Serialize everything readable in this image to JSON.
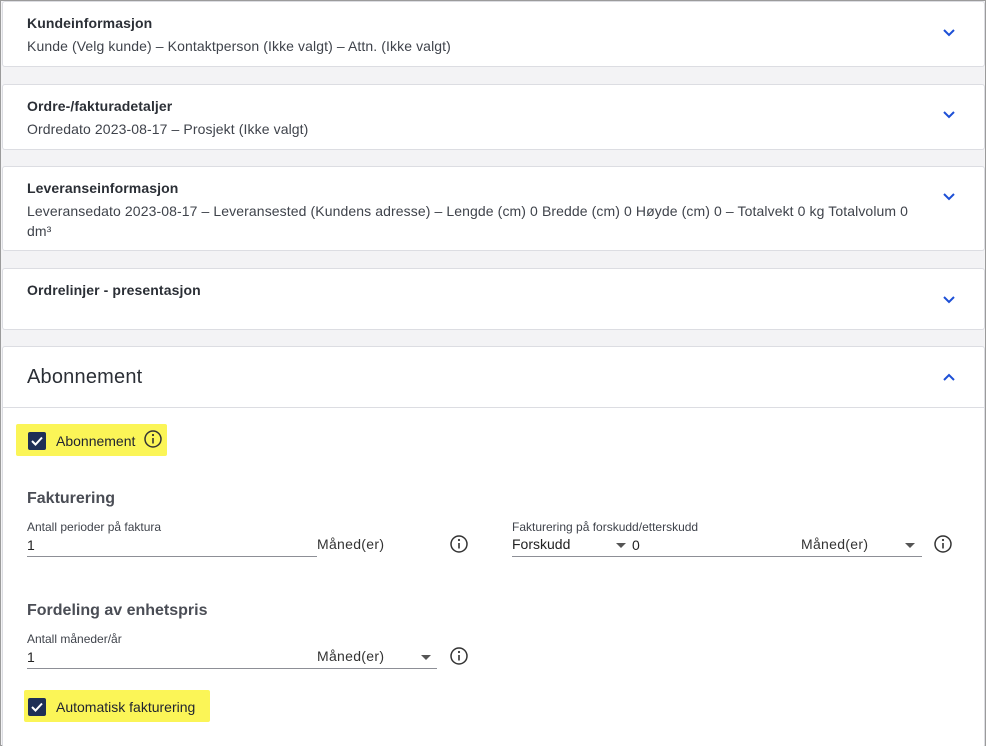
{
  "cards": [
    {
      "title": "Kundeinformasjon",
      "summary": "Kunde (Velg kunde) – Kontaktperson (Ikke valgt) – Attn. (Ikke valgt)"
    },
    {
      "title": "Ordre-/fakturadetaljer",
      "summary": "Ordredato 2023-08-17 – Prosjekt (Ikke valgt)"
    },
    {
      "title": "Leveranseinformasjon",
      "summary": "Leveransedato 2023-08-17 – Leveransested (Kundens adresse) – Lengde (cm) 0 Bredde (cm) 0 Høyde (cm) 0 – Totalvekt 0 kg Totalvolum 0 dm³"
    },
    {
      "title": "Ordrelinjer - presentasjon",
      "summary": ""
    }
  ],
  "subscription": {
    "title": "Abonnement",
    "checkbox_label": "Abonnement",
    "billing": {
      "heading": "Fakturering",
      "periods_label": "Antall perioder på faktura",
      "periods_value": "1",
      "periods_unit": "Måned(er)",
      "prepay_label": "Fakturering på forskudd/etterskudd",
      "prepay_select": "Forskudd",
      "prepay_value": "0",
      "prepay_unit": "Måned(er)"
    },
    "distribution": {
      "heading": "Fordeling av enhetspris",
      "months_label": "Antall måneder/år",
      "months_value": "1",
      "months_unit": "Måned(er)"
    },
    "auto_label": "Automatisk fakturering"
  },
  "colors": {
    "accent": "#1d4fd6",
    "highlight": "#fbf557",
    "checkbox": "#1e2f56"
  }
}
